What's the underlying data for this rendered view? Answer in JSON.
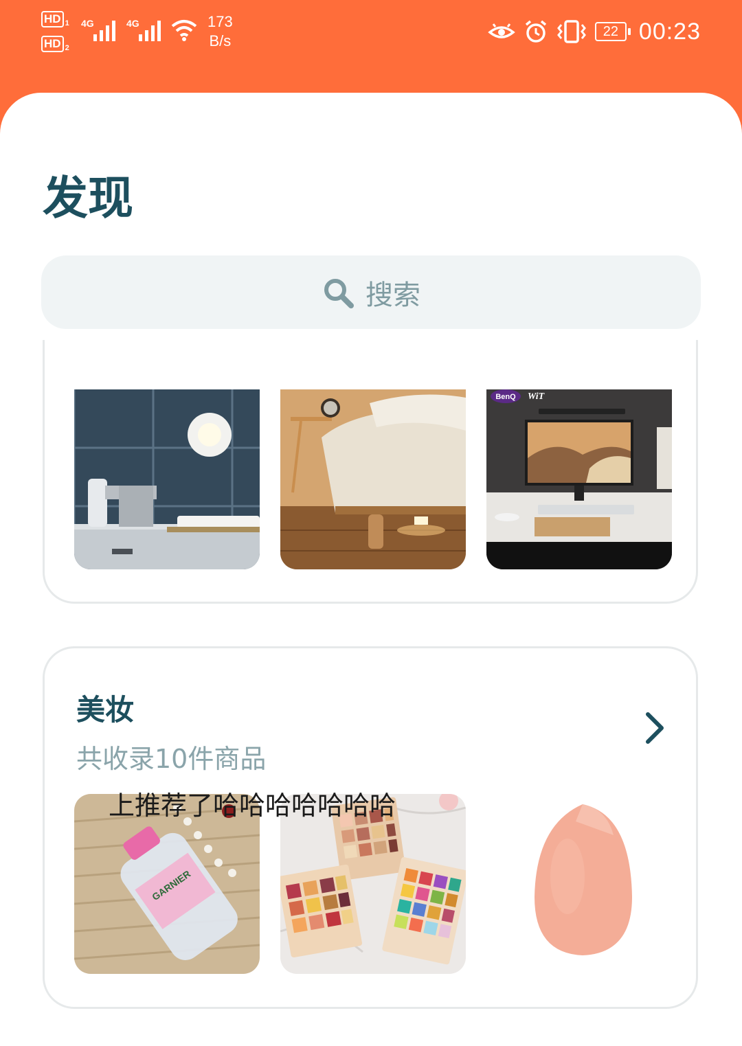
{
  "status_bar": {
    "sim1_tag": "HD",
    "sim1_index": "1",
    "sim2_tag": "HD",
    "sim2_index": "2",
    "network1": "4G",
    "network2": "4G",
    "speed_value": "173",
    "speed_unit": "B/s",
    "battery": "22",
    "time": "00:23",
    "icons": [
      "eye-comfort-icon",
      "alarm-icon",
      "vibrate-icon",
      "battery-icon",
      "wifi-icon",
      "signal-icon"
    ]
  },
  "page": {
    "title": "发现"
  },
  "search": {
    "label": "搜索",
    "icon": "search-icon"
  },
  "categories": [
    {
      "images": [
        "bathroom-night-light",
        "bedroom-night-light",
        "benq-monitor-lightbar"
      ],
      "image_text": [
        "BenQ",
        "WiT"
      ]
    },
    {
      "title": "美妆",
      "subtitle": "共收录10件商品",
      "overlay_text": "上推荐了哈哈哈哈哈哈哈",
      "images": [
        "micellar-water",
        "eyeshadow-palettes",
        "makeup-sponge"
      ],
      "image_text": [
        "GARNIER"
      ]
    }
  ],
  "colors": {
    "brand": "#ff6d3a",
    "title": "#1d4f5e",
    "muted": "#8aa4aa",
    "search_bg": "#f0f4f5"
  }
}
